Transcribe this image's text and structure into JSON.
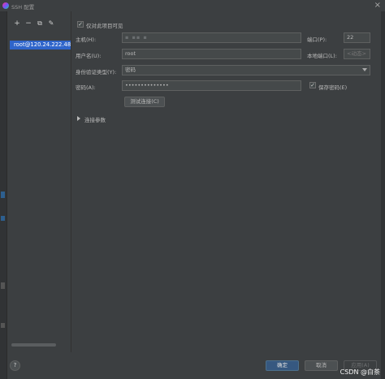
{
  "window": {
    "title": "SSH 配置",
    "close_label": "×"
  },
  "left_toolbar": {
    "add": "+",
    "remove": "−",
    "copy": "⧉",
    "edit": "✎"
  },
  "servers": [
    {
      "label": "root@120.24.222.48:"
    }
  ],
  "form": {
    "project_only_label": "仅对此项目可见",
    "host_label": "主机(H):",
    "host_value": "",
    "port_label": "端口(P):",
    "port_value": "22",
    "username_label": "用户名(U):",
    "username_value": "root",
    "local_port_label": "本地端口(L):",
    "local_port_value": "<动态>",
    "auth_type_label": "身份验证类型(Y):",
    "auth_type_value": "密码",
    "password_label": "密码(A):",
    "password_value": "••••••••••••••",
    "save_password_label": "保存密码(E)",
    "test_connection_label": "测试连接(C)",
    "connection_params_label": "连接参数"
  },
  "footer": {
    "help_label": "?",
    "ok_label": "确定",
    "cancel_label": "取消",
    "apply_label": "应用(A)"
  },
  "watermark": "CSDN @白茶",
  "colors": {
    "accent": "#2f65ca",
    "background": "#3c3f41",
    "primary_button": "#365880"
  }
}
